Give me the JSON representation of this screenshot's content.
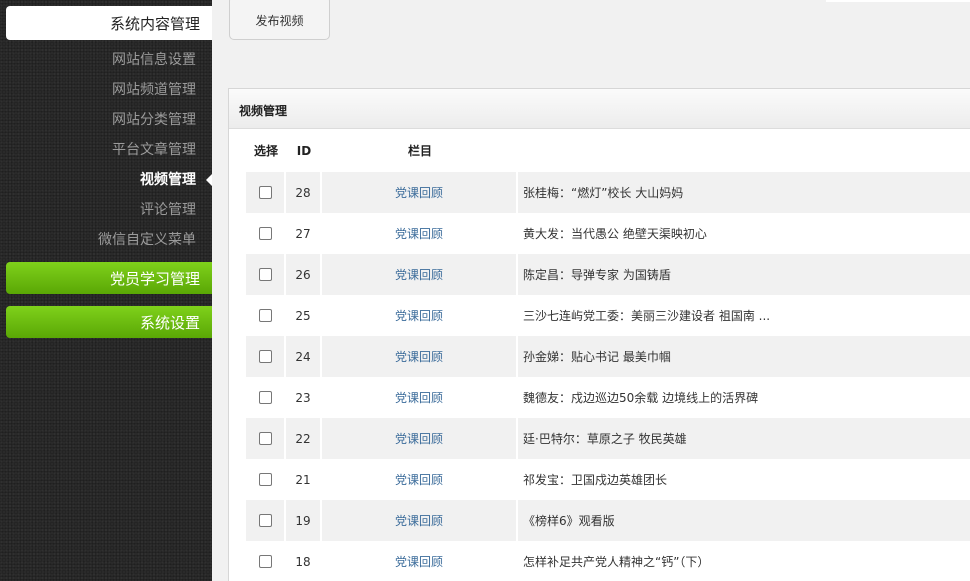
{
  "sidebar": {
    "header": "系统内容管理",
    "items": [
      {
        "label": "网站信息设置",
        "active": false
      },
      {
        "label": "网站频道管理",
        "active": false
      },
      {
        "label": "网站分类管理",
        "active": false
      },
      {
        "label": "平台文章管理",
        "active": false
      },
      {
        "label": "视频管理",
        "active": true
      },
      {
        "label": "评论管理",
        "active": false
      },
      {
        "label": "微信自定义菜单",
        "active": false
      }
    ],
    "sections": [
      {
        "label": "党员学习管理"
      },
      {
        "label": "系统设置"
      }
    ]
  },
  "toolbar": {
    "publish_label": "发布视频"
  },
  "panel": {
    "title": "视频管理",
    "columns": {
      "select": "选择",
      "id": "ID",
      "column": "栏目"
    },
    "rows": [
      {
        "id": "28",
        "column": "党课回顾",
        "title": "张桂梅：“燃灯”校长 大山妈妈"
      },
      {
        "id": "27",
        "column": "党课回顾",
        "title": "黄大发：当代愚公 绝壁天渠映初心"
      },
      {
        "id": "26",
        "column": "党课回顾",
        "title": "陈定昌：导弹专家 为国铸盾"
      },
      {
        "id": "25",
        "column": "党课回顾",
        "title": "三沙七连屿党工委：美丽三沙建设者 祖国南 ..."
      },
      {
        "id": "24",
        "column": "党课回顾",
        "title": "孙金娣：贴心书记 最美巾帼"
      },
      {
        "id": "23",
        "column": "党课回顾",
        "title": "魏德友：戍边巡边50余载 边境线上的活界碑"
      },
      {
        "id": "22",
        "column": "党课回顾",
        "title": "廷·巴特尔：草原之子 牧民英雄"
      },
      {
        "id": "21",
        "column": "党课回顾",
        "title": "祁发宝：卫国戍边英雄团长"
      },
      {
        "id": "19",
        "column": "党课回顾",
        "title": "《榜样6》观看版"
      },
      {
        "id": "18",
        "column": "党课回顾",
        "title": "怎样补足共产党人精神之“钙”（下）"
      }
    ]
  }
}
